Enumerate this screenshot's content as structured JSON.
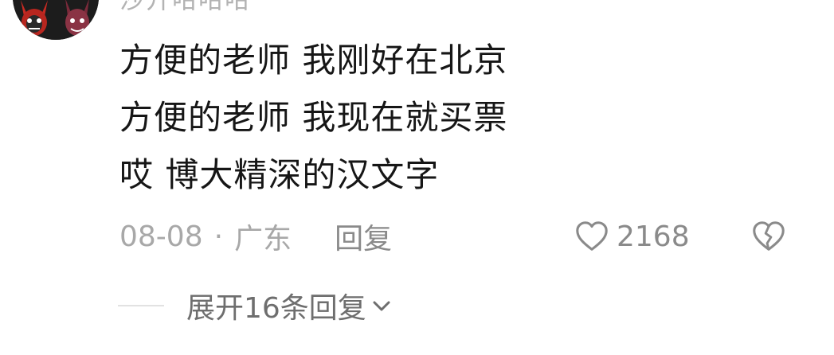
{
  "comment": {
    "username": "沙开哈哈哈",
    "lines": [
      "方便的老师 我刚好在北京",
      "方便的老师 我现在就买票",
      "哎 博大精深的汉文字"
    ],
    "date": "08-08",
    "dot": "·",
    "location": "广东",
    "reply_label": "回复",
    "like_count": "2168",
    "expand_replies_label": "展开16条回复"
  },
  "icons": {
    "like": "heart-outline-icon",
    "dislike": "broken-heart-icon",
    "expand": "chevron-down-icon"
  },
  "colors": {
    "text_primary": "#161616",
    "text_secondary": "#a8a8a8",
    "avatar_red": "#d8322a"
  }
}
